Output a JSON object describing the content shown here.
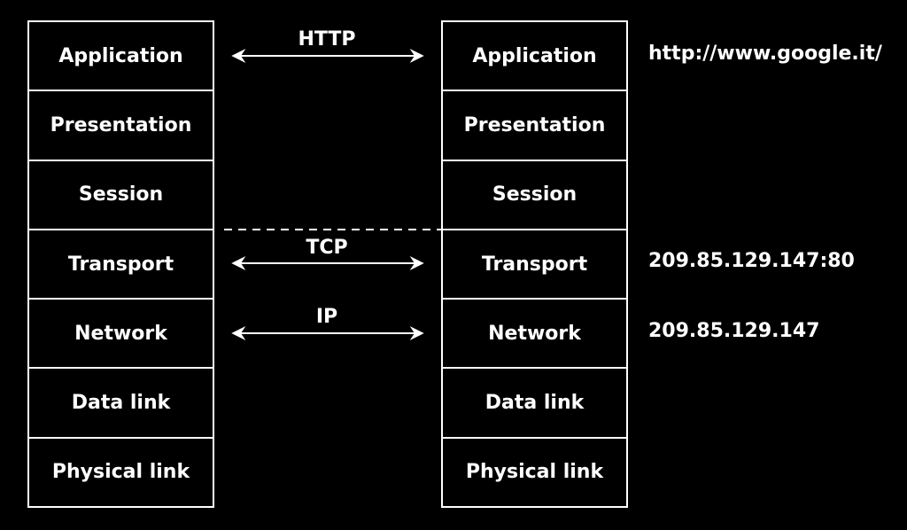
{
  "left_stack": {
    "layers": [
      "Application",
      "Presentation",
      "Session",
      "Transport",
      "Network",
      "Data link",
      "Physical link"
    ]
  },
  "right_stack": {
    "layers": [
      "Application",
      "Presentation",
      "Session",
      "Transport",
      "Network",
      "Data link",
      "Physical link"
    ]
  },
  "protocols": {
    "application": "HTTP",
    "transport": "TCP",
    "network": "IP"
  },
  "addresses": {
    "application": "http://www.google.it/",
    "transport": "209.85.129.147:80",
    "network": "209.85.129.147"
  },
  "colors": {
    "background": "#000000",
    "foreground": "#ffffff"
  }
}
